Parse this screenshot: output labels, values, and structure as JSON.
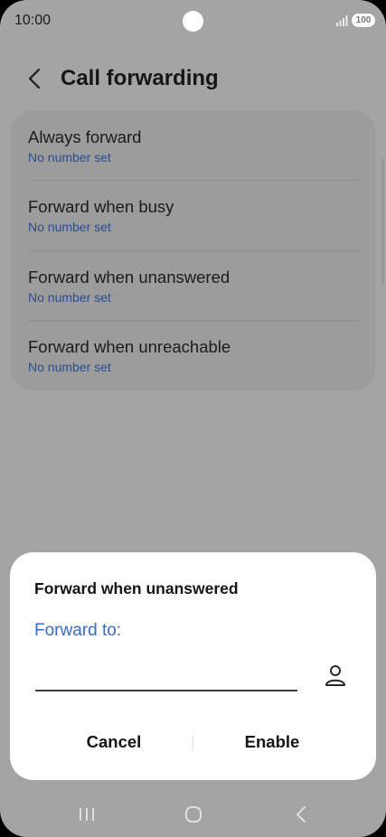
{
  "status_bar": {
    "time": "10:00",
    "battery": "100"
  },
  "header": {
    "title": "Call forwarding"
  },
  "settings": {
    "items": [
      {
        "title": "Always forward",
        "subtitle": "No number set"
      },
      {
        "title": "Forward when busy",
        "subtitle": "No number set"
      },
      {
        "title": "Forward when unanswered",
        "subtitle": "No number set"
      },
      {
        "title": "Forward when unreachable",
        "subtitle": "No number set"
      }
    ]
  },
  "dialog": {
    "title": "Forward when unanswered",
    "field_label": "Forward to:",
    "input_value": "",
    "cancel_label": "Cancel",
    "enable_label": "Enable"
  },
  "icons": {
    "back": "chevron-left-icon",
    "contact": "person-icon",
    "signal": "signal-icon",
    "battery": "battery-icon",
    "nav_recents": "recents-icon",
    "nav_home": "home-icon",
    "nav_back": "back-icon"
  },
  "colors": {
    "background": "#a4a4a4",
    "card": "#9c9c9c",
    "subtitle_blue": "#2a4d8d",
    "field_label_blue": "#3a6ac6",
    "dialog": "#ffffff"
  }
}
